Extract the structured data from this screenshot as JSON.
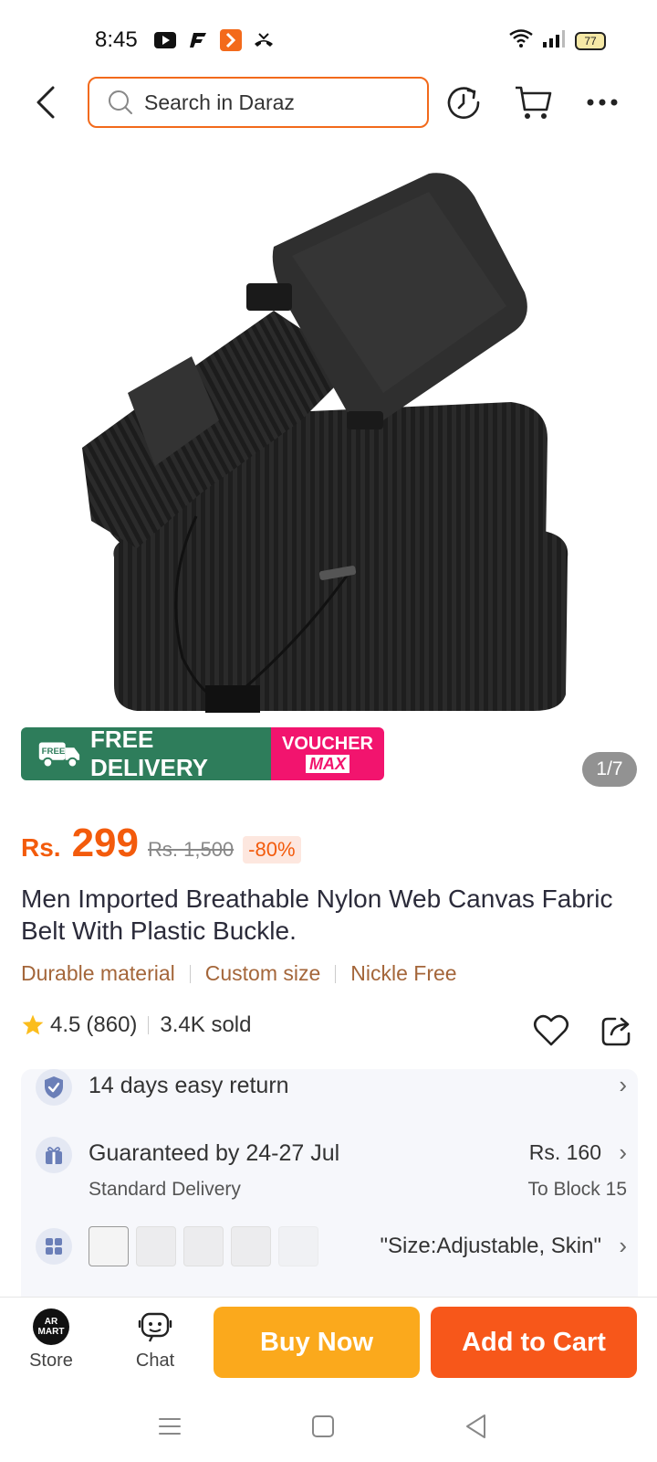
{
  "status_bar": {
    "time": "8:45",
    "battery": "77",
    "app_icons": [
      "youtube-icon",
      "f-app-icon",
      "daraz-app-icon",
      "missed-call-icon"
    ]
  },
  "search": {
    "placeholder": "Search in Daraz"
  },
  "nav_icons": [
    "back-icon",
    "history-icon",
    "cart-icon",
    "more-icon"
  ],
  "gallery": {
    "page_indicator": "1/7",
    "promo_free": "FREE DELIVERY",
    "promo_free_tag": "FREE",
    "promo_voucher_top": "VOUCHER",
    "promo_voucher_bottom": "MAX"
  },
  "price": {
    "currency": "Rs.",
    "current": "299",
    "original": "Rs. 1,500",
    "discount": "-80%"
  },
  "product": {
    "title": "Men Imported Breathable Nylon Web Canvas Fabric Belt With Plastic Buckle.",
    "features": [
      "Durable material",
      "Custom size",
      "Nickle Free"
    ]
  },
  "rating": {
    "score": "4.5",
    "count": "(860)",
    "sold": "3.4K sold"
  },
  "info": {
    "returns": "14 days easy return",
    "delivery_main": "Guaranteed by 24-27 Jul",
    "delivery_sub": "Standard Delivery",
    "delivery_price": "Rs. 160",
    "delivery_dest": "To Block 15",
    "variant_text": "\"Size:Adjustable, Skin\""
  },
  "bottom_bar": {
    "store_label": "Store",
    "store_logo_text": "AR MART",
    "chat_label": "Chat",
    "buy_now": "Buy Now",
    "add_to_cart": "Add to Cart"
  },
  "colors": {
    "accent": "#f35b0c",
    "buy_now": "#fba91c",
    "add_to_cart": "#f7571a",
    "free_delivery": "#2e7d5b",
    "voucher": "#f2146e"
  }
}
